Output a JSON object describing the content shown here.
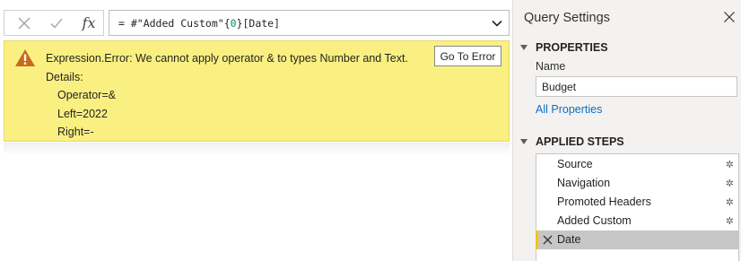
{
  "formula_bar": {
    "cancel_icon": "close-icon",
    "commit_icon": "checkmark-icon",
    "fx_label": "fx",
    "formula_prefix": "= #\"Added Custom\"{",
    "formula_index": "0",
    "formula_suffix": "}[Date]"
  },
  "error": {
    "message": "Expression.Error: We cannot apply operator & to types Number and Text.",
    "details_label": "Details:",
    "details": [
      "Operator=&",
      "Left=2022",
      "Right=-"
    ],
    "go_to_error_label": "Go To Error"
  },
  "query_settings": {
    "title": "Query Settings",
    "properties_header": "PROPERTIES",
    "name_label": "Name",
    "name_value": "Budget",
    "all_properties_link": "All Properties",
    "applied_steps_header": "APPLIED STEPS",
    "steps": [
      {
        "label": "Source",
        "has_gear": true,
        "selected": false
      },
      {
        "label": "Navigation",
        "has_gear": true,
        "selected": false
      },
      {
        "label": "Promoted Headers",
        "has_gear": true,
        "selected": false
      },
      {
        "label": "Added Custom",
        "has_gear": true,
        "selected": false
      },
      {
        "label": "Date",
        "has_gear": false,
        "selected": true
      }
    ]
  },
  "colors": {
    "error_background": "#faf082",
    "link": "#0f6cbd",
    "selected_step": "#c8c6c4",
    "selected_marker": "#f2c811",
    "warning_icon": "#c8691c"
  }
}
